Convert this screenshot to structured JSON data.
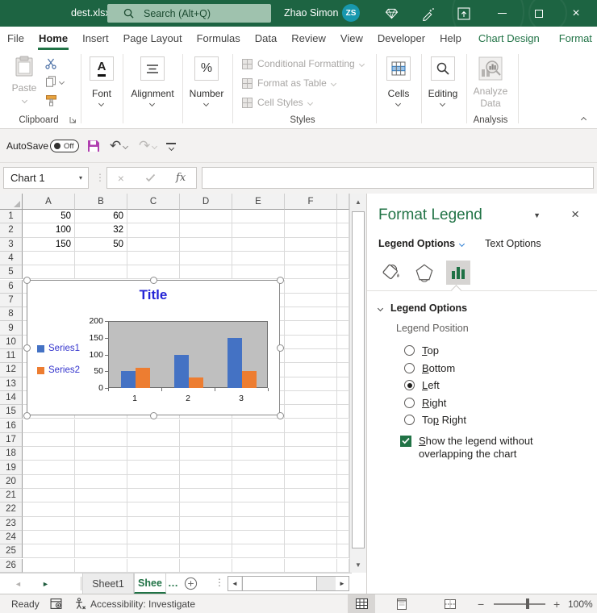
{
  "titlebar": {
    "doc_name": "dest.xlsx",
    "search_placeholder": "Search (Alt+Q)",
    "user_name": "Zhao Simon",
    "user_initials": "ZS"
  },
  "ribbon_tabs": [
    {
      "label": "File",
      "type": "normal"
    },
    {
      "label": "Home",
      "type": "active"
    },
    {
      "label": "Insert",
      "type": "normal"
    },
    {
      "label": "Page Layout",
      "type": "normal"
    },
    {
      "label": "Formulas",
      "type": "normal"
    },
    {
      "label": "Data",
      "type": "normal"
    },
    {
      "label": "Review",
      "type": "normal"
    },
    {
      "label": "View",
      "type": "normal"
    },
    {
      "label": "Developer",
      "type": "normal"
    },
    {
      "label": "Help",
      "type": "normal"
    },
    {
      "label": "Chart Design",
      "type": "contextual"
    },
    {
      "label": "Format",
      "type": "contextual"
    }
  ],
  "ribbon": {
    "clipboard": {
      "paste_label": "Paste",
      "group_label": "Clipboard"
    },
    "font": {
      "group_label": "Font",
      "icon_text": "A"
    },
    "alignment": {
      "group_label": "Alignment"
    },
    "number": {
      "group_label": "Number",
      "icon_text": "%"
    },
    "styles": {
      "items": [
        "Conditional Formatting",
        "Format as Table",
        "Cell Styles"
      ],
      "group_label": "Styles"
    },
    "cells": {
      "group_label": "Cells"
    },
    "editing": {
      "group_label": "Editing"
    },
    "analysis": {
      "button_line1": "Analyze",
      "button_line2": "Data",
      "group_label": "Analysis"
    }
  },
  "qat": {
    "autosave_label": "AutoSave",
    "autosave_state": "Off"
  },
  "formula_bar": {
    "name_box_value": "Chart 1",
    "fx_label": "fx",
    "formula_value": ""
  },
  "grid": {
    "columns": [
      "A",
      "B",
      "C",
      "D",
      "E",
      "F"
    ],
    "row_count": 27,
    "values": [
      [
        "50",
        "60"
      ],
      [
        "100",
        "32"
      ],
      [
        "150",
        "50"
      ]
    ]
  },
  "chart_data": {
    "type": "bar",
    "title": "Title",
    "title_color": "#2424d6",
    "categories": [
      "1",
      "2",
      "3"
    ],
    "series": [
      {
        "name": "Series1",
        "color": "#4472C4",
        "values": [
          50,
          100,
          150
        ]
      },
      {
        "name": "Series2",
        "color": "#ED7D31",
        "values": [
          60,
          32,
          50
        ]
      }
    ],
    "ylim": [
      0,
      200
    ],
    "yticks": [
      0,
      50,
      100,
      150,
      200
    ],
    "legend_position": "left",
    "legend_text_color": "#3434cd",
    "plot_bg": "#bfbfbf",
    "grid_on": false
  },
  "panel": {
    "title": "Format Legend",
    "tabs": [
      {
        "label": "Legend Options",
        "active": true
      },
      {
        "label": "Text Options",
        "active": false
      }
    ],
    "section_header": "Legend Options",
    "position_label": "Legend Position",
    "radios": [
      {
        "pre": "",
        "accel": "T",
        "post": "op",
        "selected": false
      },
      {
        "pre": "",
        "accel": "B",
        "post": "ottom",
        "selected": false
      },
      {
        "pre": "",
        "accel": "L",
        "post": "eft",
        "selected": true
      },
      {
        "pre": "",
        "accel": "R",
        "post": "ight",
        "selected": false
      },
      {
        "pre": "To",
        "accel": "p",
        "post": " Right",
        "selected": false
      }
    ],
    "checkbox": {
      "pre": "",
      "accel": "S",
      "post": "how the legend without overlapping the chart",
      "checked": true
    }
  },
  "sheet_bar": {
    "tabs": [
      {
        "name": "Sheet1",
        "active": false
      },
      {
        "name": "Shee",
        "active": true
      }
    ],
    "overflow_ellipsis": "…"
  },
  "status_bar": {
    "ready_label": "Ready",
    "accessibility_label": "Accessibility: Investigate",
    "zoom_value": "100%"
  }
}
